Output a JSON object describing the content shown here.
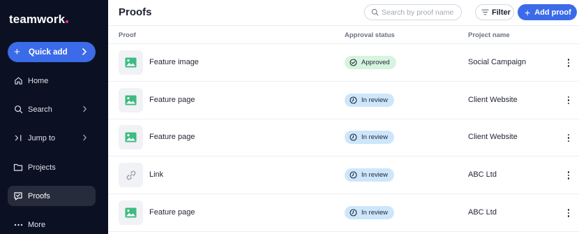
{
  "sidebar": {
    "logo_text": "teamwork",
    "quick_add_label": "Quick add",
    "items": [
      {
        "label": "Home",
        "icon": "home-icon"
      },
      {
        "label": "Search",
        "icon": "search-icon"
      },
      {
        "label": "Jump to",
        "icon": "jump-to-icon"
      },
      {
        "label": "Projects",
        "icon": "folder-icon"
      },
      {
        "label": "Proofs",
        "icon": "proofs-icon",
        "active": true
      },
      {
        "label": "More",
        "icon": "more-icon"
      }
    ]
  },
  "header": {
    "title": "Proofs",
    "search_placeholder": "Search by proof name",
    "filter_label": "Filter",
    "add_label": "Add proof"
  },
  "table": {
    "columns": [
      "Proof",
      "Approval status",
      "Project name"
    ],
    "rows": [
      {
        "name": "Feature image",
        "type": "image",
        "status": "Approved",
        "project": "Social Campaign"
      },
      {
        "name": "Feature page",
        "type": "image",
        "status": "In review",
        "project": "Client Website"
      },
      {
        "name": "Feature page",
        "type": "image",
        "status": "In review",
        "project": "Client Website"
      },
      {
        "name": "Link",
        "type": "link",
        "status": "In review",
        "project": "ABC Ltd"
      },
      {
        "name": "Feature page",
        "type": "image",
        "status": "In review",
        "project": "ABC Ltd"
      }
    ]
  },
  "colors": {
    "sidebar_bg": "#0b1122",
    "accent": "#3b6be8",
    "logo_dot": "#ff2e8a",
    "approved_bg": "#d6f4e0",
    "review_bg": "#cde6fb",
    "image_icon": "#3dbb82"
  }
}
